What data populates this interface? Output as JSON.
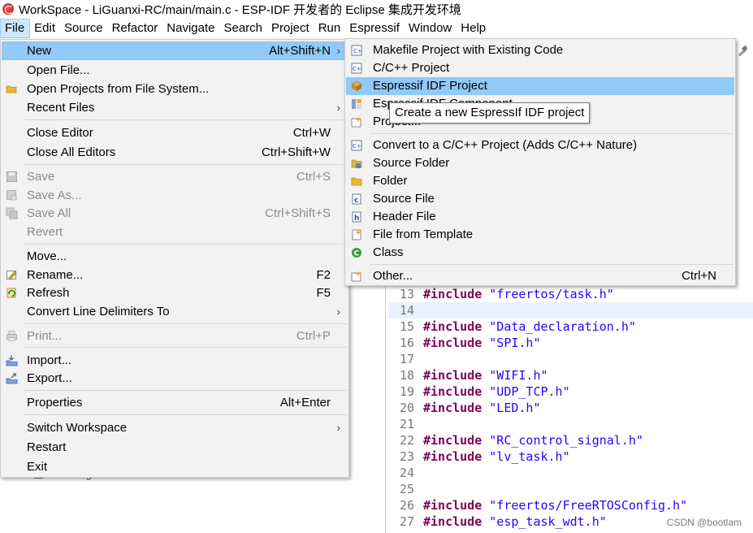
{
  "window": {
    "title": "WorkSpace - LiGuanxi-RC/main/main.c - ESP-IDF 开发者的 Eclipse 集成开发环境"
  },
  "menubar": {
    "items": [
      {
        "label": "File"
      },
      {
        "label": "Edit"
      },
      {
        "label": "Source"
      },
      {
        "label": "Refactor"
      },
      {
        "label": "Navigate"
      },
      {
        "label": "Search"
      },
      {
        "label": "Project"
      },
      {
        "label": "Run"
      },
      {
        "label": "Espressif"
      },
      {
        "label": "Window"
      },
      {
        "label": "Help"
      }
    ]
  },
  "file_menu": {
    "items": [
      {
        "label": "New",
        "accel": "Alt+Shift+N",
        "submenu": true,
        "highlighted": true
      },
      {
        "label": "Open File...",
        "accel": ""
      },
      {
        "label": "Open Projects from File System...",
        "accel": ""
      },
      {
        "label": "Recent Files",
        "accel": "",
        "submenu": true
      },
      {
        "label": "Close Editor",
        "accel": "Ctrl+W"
      },
      {
        "label": "Close All Editors",
        "accel": "Ctrl+Shift+W"
      },
      {
        "label": "Save",
        "accel": "Ctrl+S",
        "disabled": true
      },
      {
        "label": "Save As...",
        "accel": "",
        "disabled": true
      },
      {
        "label": "Save All",
        "accel": "Ctrl+Shift+S",
        "disabled": true
      },
      {
        "label": "Revert",
        "accel": "",
        "disabled": true
      },
      {
        "label": "Move...",
        "accel": ""
      },
      {
        "label": "Rename...",
        "accel": "F2"
      },
      {
        "label": "Refresh",
        "accel": "F5"
      },
      {
        "label": "Convert Line Delimiters To",
        "accel": "",
        "submenu": true
      },
      {
        "label": "Print...",
        "accel": "Ctrl+P",
        "disabled": true
      },
      {
        "label": "Import...",
        "accel": ""
      },
      {
        "label": "Export...",
        "accel": ""
      },
      {
        "label": "Properties",
        "accel": "Alt+Enter"
      },
      {
        "label": "Switch Workspace",
        "accel": "",
        "submenu": true
      },
      {
        "label": "Restart",
        "accel": ""
      },
      {
        "label": "Exit",
        "accel": ""
      }
    ]
  },
  "new_submenu": {
    "items": [
      {
        "label": "Makefile Project with Existing Code",
        "accel": ""
      },
      {
        "label": "C/C++ Project",
        "accel": ""
      },
      {
        "label": "Espressif IDF Project",
        "accel": "",
        "highlighted": true
      },
      {
        "label": "Espressif IDF Component",
        "accel": ""
      },
      {
        "label": "Project...",
        "accel": ""
      },
      {
        "label": "Convert to a C/C++ Project (Adds C/C++ Nature)",
        "accel": ""
      },
      {
        "label": "Source Folder",
        "accel": ""
      },
      {
        "label": "Folder",
        "accel": ""
      },
      {
        "label": "Source File",
        "accel": ""
      },
      {
        "label": "Header File",
        "accel": ""
      },
      {
        "label": "File from Template",
        "accel": ""
      },
      {
        "label": "Class",
        "accel": ""
      },
      {
        "label": "Other...",
        "accel": "Ctrl+N"
      }
    ]
  },
  "tooltip": {
    "text": "Create a new EspressIf IDF project"
  },
  "background": {
    "package_label": "sdkconfig.old"
  },
  "editor": {
    "lines": [
      {
        "num": "13",
        "keyword": "#include",
        "value": "\"freertos/task.h\""
      },
      {
        "num": "14",
        "keyword": "",
        "value": "",
        "current": true
      },
      {
        "num": "15",
        "keyword": "#include",
        "value": "\"Data_declaration.h\""
      },
      {
        "num": "16",
        "keyword": "#include",
        "value": "\"SPI.h\""
      },
      {
        "num": "17",
        "keyword": "",
        "value": ""
      },
      {
        "num": "18",
        "keyword": "#include",
        "value": "\"WIFI.h\""
      },
      {
        "num": "19",
        "keyword": "#include",
        "value": "\"UDP_TCP.h\""
      },
      {
        "num": "20",
        "keyword": "#include",
        "value": "\"LED.h\""
      },
      {
        "num": "21",
        "keyword": "",
        "value": ""
      },
      {
        "num": "22",
        "keyword": "#include",
        "value": "\"RC_control_signal.h\""
      },
      {
        "num": "23",
        "keyword": "#include",
        "value": "\"lv_task.h\""
      },
      {
        "num": "24",
        "keyword": "",
        "value": ""
      },
      {
        "num": "25",
        "keyword": "",
        "value": ""
      },
      {
        "num": "26",
        "keyword": "#include",
        "value": "\"freertos/FreeRTOSConfig.h\""
      },
      {
        "num": "27",
        "keyword": "#include",
        "value": "\"esp_task_wdt.h\""
      }
    ]
  },
  "watermark": {
    "text": "CSDN @bootlam"
  }
}
